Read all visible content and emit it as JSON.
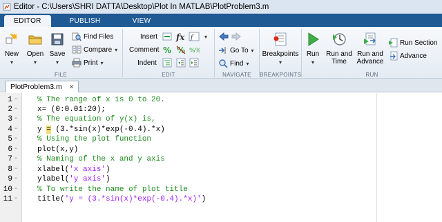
{
  "window": {
    "title": "Editor - C:\\Users\\SHRI DATTA\\Desktop\\Plot In MATLAB\\PlotProblem3.m"
  },
  "tabs": [
    "EDITOR",
    "PUBLISH",
    "VIEW"
  ],
  "ribbon": {
    "file": {
      "label": "FILE",
      "new": "New",
      "open": "Open",
      "save": "Save",
      "find_files": "Find Files",
      "compare": "Compare",
      "print": "Print"
    },
    "edit": {
      "label": "EDIT",
      "insert": "Insert",
      "comment": "Comment",
      "indent": "Indent"
    },
    "navigate": {
      "label": "NAVIGATE",
      "goto": "Go To",
      "find": "Find"
    },
    "breakpoints": {
      "label": "BREAKPOINTS",
      "breakpoints": "Breakpoints"
    },
    "run": {
      "label": "RUN",
      "run": "Run",
      "run_and_time_1": "Run and",
      "run_and_time_2": "Time",
      "run_and_advance_1": "Run and",
      "run_and_advance_2": "Advance",
      "run_section": "Run Section",
      "advance": "Advance"
    }
  },
  "document": {
    "tab": "PlotProblem3.m"
  },
  "code": {
    "lines": [
      {
        "num": "1",
        "text": "% The range of x is 0 to 20."
      },
      {
        "num": "2",
        "text": "x= (0:0.01:20);"
      },
      {
        "num": "3",
        "text": "% The equation of y(x) is,"
      },
      {
        "num": "4",
        "pre": "y ",
        "hl": "=",
        "post": " (3.*sin(x)*exp(-0.4).*x)"
      },
      {
        "num": "5",
        "text": "% Using the plot function"
      },
      {
        "num": "6",
        "text": "plot(x,y)"
      },
      {
        "num": "7",
        "text": "% Naming of the x and y axis"
      },
      {
        "num": "8",
        "pre": "xlabel(",
        "str": "'x axis'",
        "post": ")"
      },
      {
        "num": "9",
        "pre": "ylabel(",
        "str": "'y axis'",
        "post": ")"
      },
      {
        "num": "10",
        "text": "% To write the name of plot title"
      },
      {
        "num": "11",
        "pre": "title(",
        "str": "'y = (3.*sin(x)*exp(-0.4).*x)'",
        "post": ")"
      }
    ],
    "marker": "-"
  },
  "colors": {
    "comment": "#228b22",
    "string": "#a020f0",
    "tabbar": "#1f5a94"
  }
}
